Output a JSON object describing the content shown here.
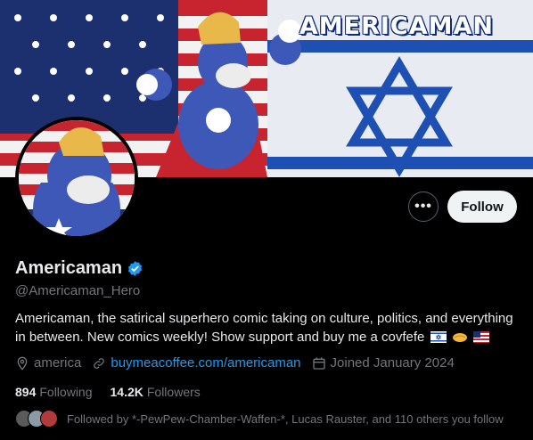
{
  "banner": {
    "title": "AMERICAMAN"
  },
  "profile": {
    "display_name": "Americaman",
    "handle": "@Americaman_Hero",
    "bio": "Americaman, the satirical superhero comic taking on culture, politics, and everything in between. New comics weekly! Show support and buy me a covfefe",
    "location": "america",
    "website": "buymeacoffee.com/americaman",
    "joined": "Joined January 2024"
  },
  "actions": {
    "more_label": "•••",
    "follow_label": "Follow"
  },
  "stats": {
    "following_count": "894",
    "following_label": "Following",
    "followers_count": "14.2K",
    "followers_label": "Followers"
  },
  "followed_by": "Followed by *-PewPew-Chamber-Waffen-*, Lucas Rauster, and 110 others you follow",
  "colors": {
    "link": "#1d9bf0",
    "verified": "#1d9bf0",
    "muted": "#71767b",
    "background": "#000000"
  },
  "icons": [
    "verified-badge-icon",
    "location-icon",
    "link-icon",
    "calendar-icon",
    "israel-flag-icon",
    "handshake-icon",
    "us-flag-icon"
  ]
}
